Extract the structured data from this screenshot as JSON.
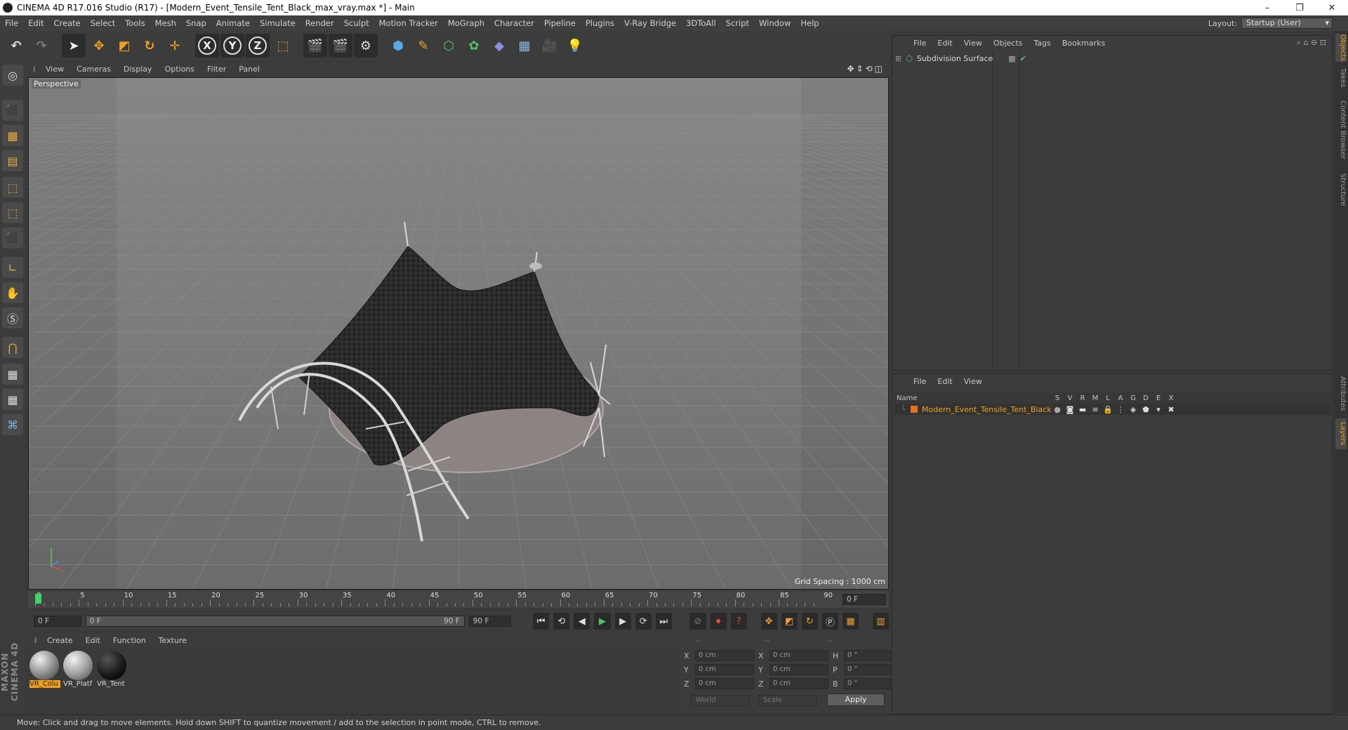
{
  "window": {
    "title": "CINEMA 4D R17.016 Studio (R17) - [Modern_Event_Tensile_Tent_Black_max_vray.max *] - Main",
    "controls": [
      "–",
      "❐",
      "✕"
    ]
  },
  "menu": [
    "File",
    "Edit",
    "Create",
    "Select",
    "Tools",
    "Mesh",
    "Snap",
    "Animate",
    "Simulate",
    "Render",
    "Sculpt",
    "Motion Tracker",
    "MoGraph",
    "Character",
    "Pipeline",
    "Plugins",
    "V-Ray Bridge",
    "3DToAll",
    "Script",
    "Window",
    "Help"
  ],
  "layout": {
    "label": "Layout:",
    "value": "Startup (User)"
  },
  "toolbar": {
    "axis_x": "X",
    "axis_y": "Y",
    "axis_z": "Z"
  },
  "viewport": {
    "menu": [
      "View",
      "Cameras",
      "Display",
      "Options",
      "Filter",
      "Panel"
    ],
    "label": "Perspective",
    "grid_spacing": "Grid Spacing : 1000 cm"
  },
  "timeline": {
    "ticks": [
      "0",
      "5",
      "10",
      "15",
      "20",
      "25",
      "30",
      "35",
      "40",
      "45",
      "50",
      "55",
      "60",
      "65",
      "70",
      "75",
      "80",
      "85",
      "90"
    ],
    "current_frame": "0 F",
    "start": "0 F",
    "range_start": "0 F",
    "range_end": "90 F",
    "end": "90 F"
  },
  "materials": {
    "menu": [
      "Create",
      "Edit",
      "Function",
      "Texture"
    ],
    "items": [
      {
        "label": "VR_Colu"
      },
      {
        "label": "VR_Platf"
      },
      {
        "label": "VR_Tent"
      }
    ]
  },
  "coords": {
    "headers": [
      "--",
      "--",
      "--"
    ],
    "rows": [
      {
        "l1": "X",
        "v1": "0 cm",
        "l2": "X",
        "v2": "0 cm",
        "l3": "H",
        "v3": "0 °"
      },
      {
        "l1": "Y",
        "v1": "0 cm",
        "l2": "Y",
        "v2": "0 cm",
        "l3": "P",
        "v3": "0 °"
      },
      {
        "l1": "Z",
        "v1": "0 cm",
        "l2": "Z",
        "v2": "0 cm",
        "l3": "B",
        "v3": "0 °"
      }
    ],
    "world": "World",
    "scale": "Scale",
    "apply": "Apply"
  },
  "objects": {
    "menu": [
      "File",
      "Edit",
      "View",
      "Objects",
      "Tags",
      "Bookmarks"
    ],
    "item": "Subdivision Surface"
  },
  "layers": {
    "menu": [
      "File",
      "Edit",
      "View"
    ],
    "columns": {
      "name": "Name",
      "flags": [
        "S",
        "V",
        "R",
        "M",
        "L",
        "A",
        "G",
        "D",
        "E",
        "X"
      ]
    },
    "item": "Modern_Event_Tensile_Tent_Black"
  },
  "side_tabs": [
    "Objects",
    "Takes",
    "Content Browser",
    "Structure",
    "Attributes",
    "Layers"
  ],
  "brand": "MAXON CINEMA 4D",
  "status": "Move: Click and drag to move elements. Hold down SHIFT to quantize movement / add to the selection in point mode, CTRL to remove.",
  "colors": {
    "accent": "#f0a020",
    "viewport_bg": "#7a7a7a",
    "tent": "#2a2a2a"
  }
}
